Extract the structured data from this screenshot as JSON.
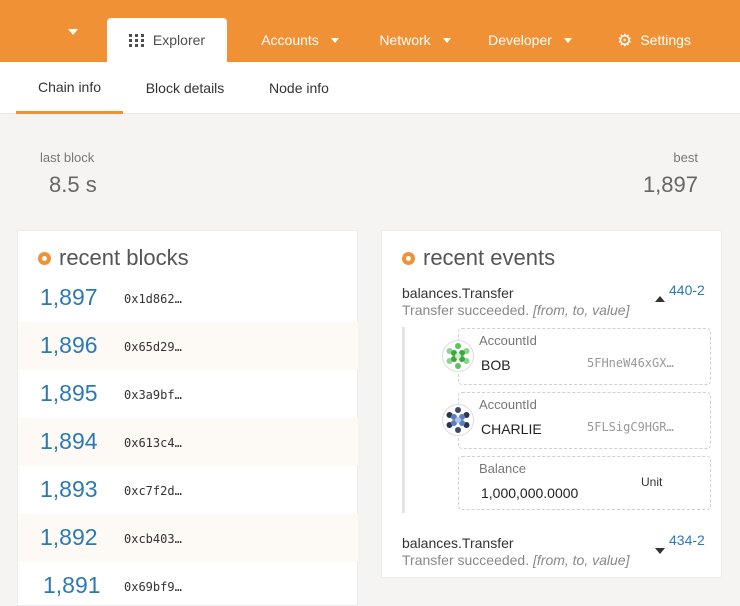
{
  "nav": {
    "tabs": [
      {
        "label": "Explorer",
        "icon": "grid-icon"
      },
      {
        "label": "Accounts"
      },
      {
        "label": "Network"
      },
      {
        "label": "Developer"
      },
      {
        "label": "Settings",
        "icon": "gear-icon"
      }
    ]
  },
  "subtabs": [
    "Chain info",
    "Block details",
    "Node info"
  ],
  "summary": {
    "last_block_label": "last block",
    "last_block_value": "8.5 s",
    "best_label": "best",
    "best_value": "1,897"
  },
  "recent_blocks": {
    "title": "recent blocks",
    "rows": [
      {
        "number": "1,897",
        "hash": "0x1d862…"
      },
      {
        "number": "1,896",
        "hash": "0x65d29…"
      },
      {
        "number": "1,895",
        "hash": "0x3a9bf…"
      },
      {
        "number": "1,894",
        "hash": "0x613c4…"
      },
      {
        "number": "1,893",
        "hash": "0xc7f2d…"
      },
      {
        "number": "1,892",
        "hash": "0xcb403…"
      },
      {
        "number": "1,891",
        "hash": "0x69bf9…"
      }
    ]
  },
  "recent_events": {
    "title": "recent events",
    "events": [
      {
        "name": "balances.Transfer",
        "desc_prefix": "Transfer succeeded. ",
        "desc_args": "[from, to, value]",
        "id": "440-2",
        "expanded": true,
        "params": [
          {
            "label": "AccountId",
            "name": "BOB",
            "address": "5FHneW46xGX…"
          },
          {
            "label": "AccountId",
            "name": "CHARLIE",
            "address": "5FLSigC9HGR…"
          },
          {
            "label": "Balance",
            "value": "1,000,000.0000",
            "unit": "Unit"
          }
        ]
      },
      {
        "name": "balances.Transfer",
        "desc_prefix": "Transfer succeeded. ",
        "desc_args": "[from, to, value]",
        "id": "434-2",
        "expanded": false
      }
    ]
  },
  "colors": {
    "accent": "#f19135",
    "link": "#2b79b5"
  }
}
